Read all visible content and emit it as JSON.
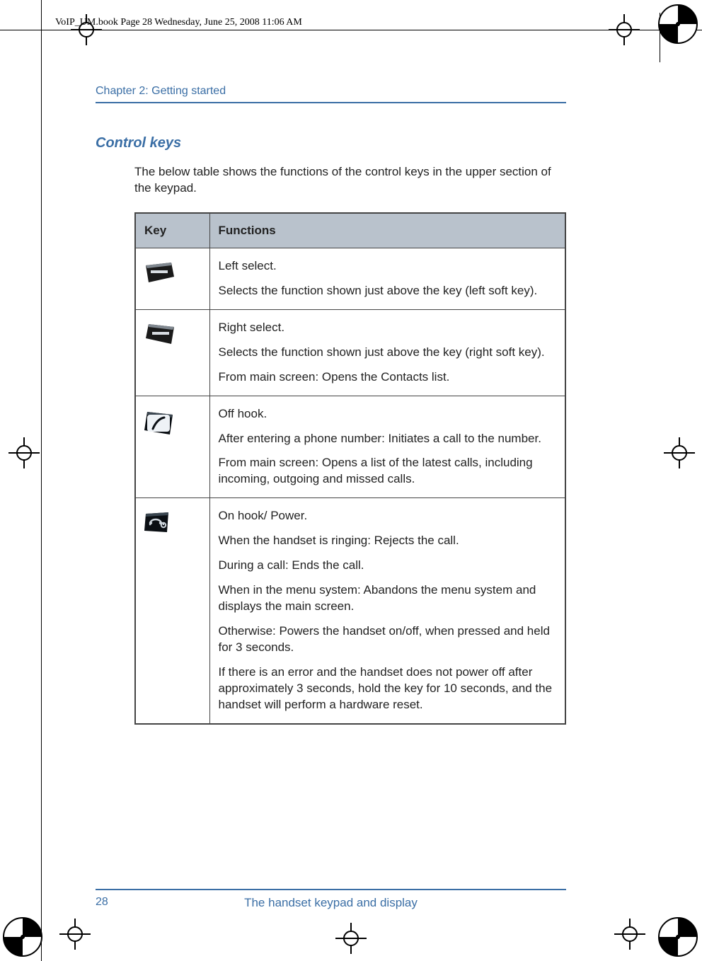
{
  "crop_header": "VoIP_UM.book  Page 28  Wednesday, June 25, 2008  11:06 AM",
  "chapter": "Chapter 2:  Getting started",
  "section_heading": "Control keys",
  "intro": "The below table shows the functions of the control keys in the upper section of the keypad.",
  "table": {
    "headers": {
      "key": "Key",
      "functions": "Functions"
    },
    "rows": [
      {
        "icon": "left-select-key-icon",
        "paras": [
          "Left select.",
          "Selects the function shown just above the key (left soft key)."
        ]
      },
      {
        "icon": "right-select-key-icon",
        "paras": [
          "Right select.",
          "Selects the function shown just above the key (right soft key).",
          "From main screen: Opens the Contacts list."
        ]
      },
      {
        "icon": "off-hook-key-icon",
        "paras": [
          "Off hook.",
          "After entering a phone number: Initiates a call to the number.",
          "From main screen: Opens a list of the latest calls, including incoming, outgoing and missed calls."
        ]
      },
      {
        "icon": "on-hook-power-key-icon",
        "paras": [
          "On hook/ Power.",
          "When the handset is ringing: Rejects the call.",
          "During a call: Ends the call.",
          "When in the menu system: Abandons the menu system and displays the main screen.",
          "Otherwise: Powers the handset on/off, when pressed and held for 3 seconds.",
          "If there is an error and the handset does not power off after approximately 3 seconds, hold the key for 10 seconds, and the handset will perform a hardware reset."
        ]
      }
    ]
  },
  "footer": {
    "page_number": "28",
    "title": "The handset keypad and display"
  }
}
